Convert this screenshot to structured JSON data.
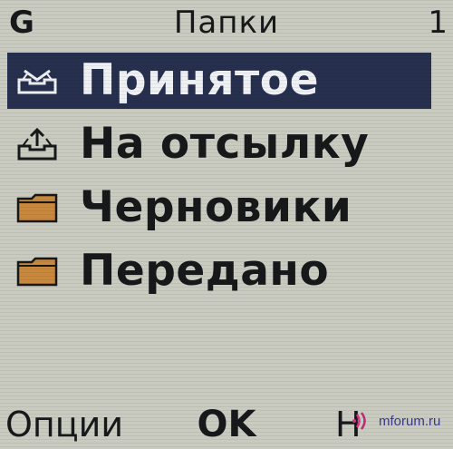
{
  "status_bar": {
    "network_letter": "G",
    "title": "Папки",
    "count": "1"
  },
  "folders": [
    {
      "label": "Принятое",
      "icon": "inbox-icon",
      "selected": true
    },
    {
      "label": "На отсылку",
      "icon": "outbox-icon",
      "selected": false
    },
    {
      "label": "Черновики",
      "icon": "folder-icon",
      "selected": false
    },
    {
      "label": "Передано",
      "icon": "folder-icon",
      "selected": false
    }
  ],
  "softkeys": {
    "left": "Опции",
    "center": "OK",
    "right": "Н"
  },
  "watermark": {
    "text": "mforum.ru"
  },
  "colors": {
    "screen_bg": "#c9cbc0",
    "selection_bg": "#26304e",
    "folder_icon": "#c9883c"
  }
}
